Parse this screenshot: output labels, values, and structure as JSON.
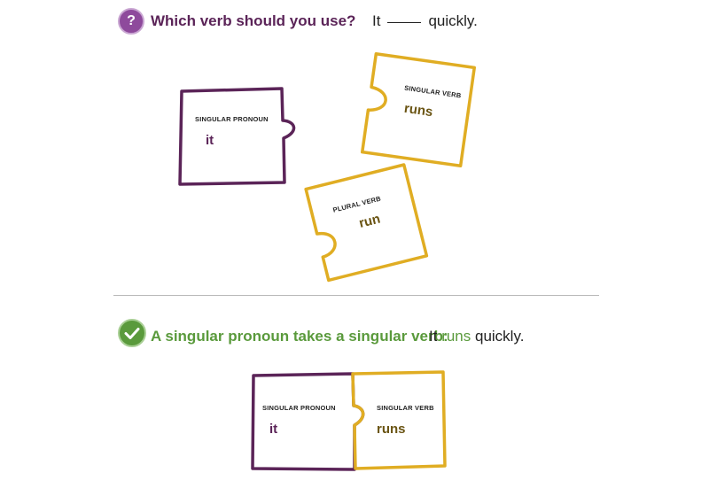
{
  "question": {
    "badge": "?",
    "text": "Which verb should you use?",
    "sentence_before": "It",
    "sentence_after": "quickly."
  },
  "pieces": [
    {
      "label": "SINGULAR  PRONOUN",
      "word": "it"
    },
    {
      "label": "SINGULAR VERB",
      "word": "runs"
    },
    {
      "label": "PLURAL VERB",
      "word": "run"
    }
  ],
  "answer": {
    "text": "A singular pronoun takes a singular verb:",
    "sentence_start": "It",
    "verb": "runs",
    "sentence_end": "quickly."
  },
  "solution": [
    {
      "label": "SINGULAR PRONOUN",
      "word": "it"
    },
    {
      "label": "SINGULAR VERB",
      "word": "runs"
    }
  ],
  "colors": {
    "purple": "#5b2458",
    "gold": "#e0ad23",
    "green": "#5a9a3c"
  }
}
